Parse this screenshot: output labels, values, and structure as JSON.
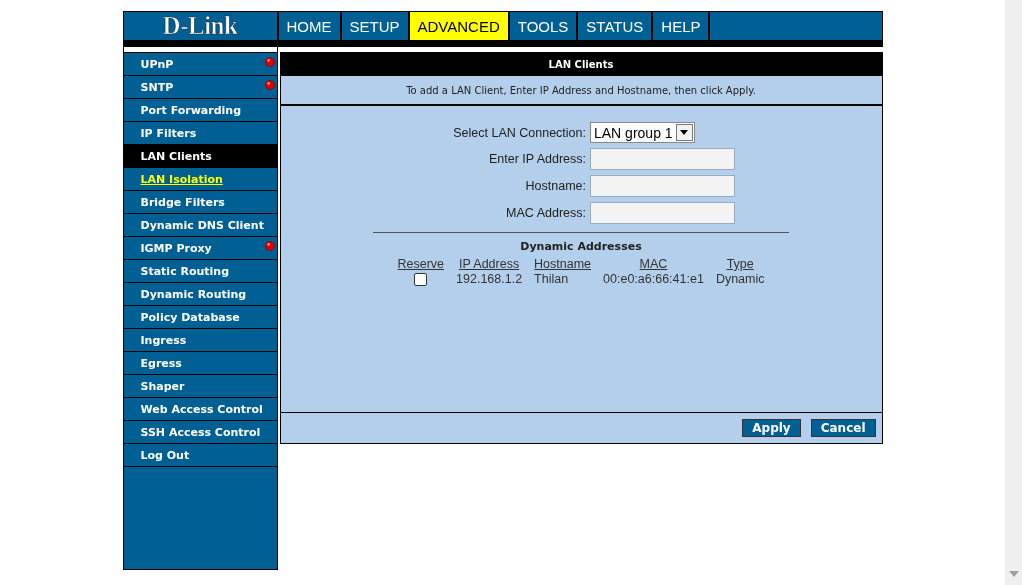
{
  "logo": "D-Link",
  "nav": [
    {
      "label": "HOME",
      "selected": false
    },
    {
      "label": "SETUP",
      "selected": false
    },
    {
      "label": "ADVANCED",
      "selected": true
    },
    {
      "label": "TOOLS",
      "selected": false
    },
    {
      "label": "STATUS",
      "selected": false
    },
    {
      "label": "HELP",
      "selected": false
    }
  ],
  "sidebar": {
    "items": [
      {
        "label": "UPnP",
        "selected": false,
        "highlighted": false,
        "alert": true
      },
      {
        "label": "SNTP",
        "selected": false,
        "highlighted": false,
        "alert": true
      },
      {
        "label": "Port Forwarding",
        "selected": false,
        "highlighted": false,
        "alert": false
      },
      {
        "label": "IP Filters",
        "selected": false,
        "highlighted": false,
        "alert": false
      },
      {
        "label": "LAN Clients",
        "selected": true,
        "highlighted": false,
        "alert": false
      },
      {
        "label": "LAN Isolation",
        "selected": false,
        "highlighted": true,
        "alert": false
      },
      {
        "label": "Bridge Filters",
        "selected": false,
        "highlighted": false,
        "alert": false
      },
      {
        "label": "Dynamic DNS Client",
        "selected": false,
        "highlighted": false,
        "alert": false
      },
      {
        "label": "IGMP Proxy",
        "selected": false,
        "highlighted": false,
        "alert": true
      },
      {
        "label": "Static Routing",
        "selected": false,
        "highlighted": false,
        "alert": false
      },
      {
        "label": "Dynamic Routing",
        "selected": false,
        "highlighted": false,
        "alert": false
      },
      {
        "label": "Policy Database",
        "selected": false,
        "highlighted": false,
        "alert": false
      },
      {
        "label": "Ingress",
        "selected": false,
        "highlighted": false,
        "alert": false
      },
      {
        "label": "Egress",
        "selected": false,
        "highlighted": false,
        "alert": false
      },
      {
        "label": "Shaper",
        "selected": false,
        "highlighted": false,
        "alert": false
      },
      {
        "label": "Web Access Control",
        "selected": false,
        "highlighted": false,
        "alert": false
      },
      {
        "label": "SSH Access Control",
        "selected": false,
        "highlighted": false,
        "alert": false
      },
      {
        "label": "Log Out",
        "selected": false,
        "highlighted": false,
        "alert": false
      }
    ]
  },
  "panel": {
    "title": "LAN Clients",
    "instructions": "To add a LAN Client, Enter IP Address and Hostname, then click Apply.",
    "form": [
      {
        "kind": "select",
        "label": "Select LAN Connection:",
        "value": "LAN group 1"
      },
      {
        "kind": "text",
        "label": "Enter IP Address:"
      },
      {
        "kind": "text",
        "label": "Hostname:"
      },
      {
        "kind": "text",
        "label": "MAC Address:"
      }
    ],
    "dynamic_addresses": {
      "title": "Dynamic Addresses",
      "columns": [
        "Reserve",
        "IP Address",
        "Hostname",
        "MAC",
        "Type"
      ],
      "rows": [
        {
          "reserve": false,
          "ip_address": "192.168.1.2",
          "hostname": "Thilan",
          "mac": "00:e0:a6:66:41:e1",
          "type": "Dynamic"
        }
      ]
    },
    "buttons": [
      "Apply",
      "Cancel"
    ]
  }
}
